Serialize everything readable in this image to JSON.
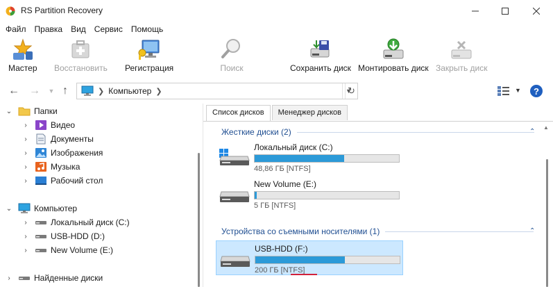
{
  "window": {
    "title": "RS Partition Recovery",
    "min_icon": "minimize-icon",
    "max_icon": "maximize-icon",
    "close_icon": "close-icon"
  },
  "menu": [
    "Файл",
    "Правка",
    "Вид",
    "Сервис",
    "Помощь"
  ],
  "toolbar": {
    "wizard": "Мастер",
    "restore": "Восстановить",
    "register": "Регистрация",
    "search": "Поиск",
    "save_disk": "Сохранить диск",
    "mount_disk": "Монтировать диск",
    "close_disk": "Закрыть диск"
  },
  "address": {
    "path": "Компьютер"
  },
  "tree": {
    "folders": "Папки",
    "video": "Видео",
    "documents": "Документы",
    "images": "Изображения",
    "music": "Музыка",
    "desktop": "Рабочий стол",
    "computer": "Компьютер",
    "local_c": "Локальный диск (C:)",
    "usb_d": "USB-HDD (D:)",
    "new_e": "New Volume (E:)",
    "found": "Найденные диски"
  },
  "tabs": {
    "disk_list": "Список дисков",
    "disk_manager": "Менеджер дисков"
  },
  "groups": {
    "hard_disks": "Жесткие диски (2)",
    "removable": "Устройства со съемными носителями (1)"
  },
  "disks": [
    {
      "name": "Локальный диск (C:)",
      "size": "48,86 ГБ [NTFS]",
      "fill": 0.62
    },
    {
      "name": "New Volume (E:)",
      "size": "5 ГБ [NTFS]",
      "fill": 0.015
    },
    {
      "name": "USB-HDD (F:)",
      "size": "200 ГБ [NTFS]",
      "fill": 0.62
    }
  ],
  "colors": {
    "accent": "#2c9ad8",
    "group_text": "#1f4e91",
    "selection": "#cce8ff",
    "underline": "#d1213a"
  }
}
